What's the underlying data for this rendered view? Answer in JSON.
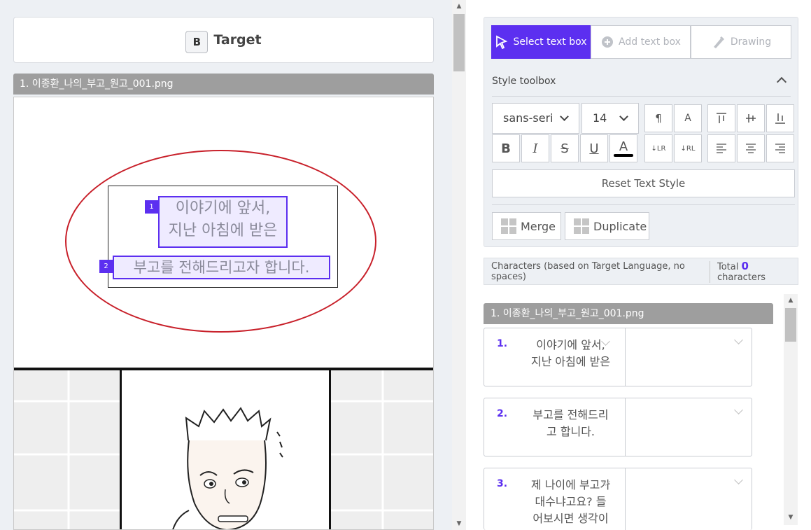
{
  "left_panel": {
    "target_badge": "B",
    "target_title": "Target",
    "file_name": "1. 이종환_나의_부고_원고_001.png",
    "text_boxes": [
      {
        "number": "1",
        "line1": "이야기에 앞서,",
        "line2": "지난 아침에 받은"
      },
      {
        "number": "2",
        "line1": "부고를 전해드리고자 합니다."
      }
    ]
  },
  "toolbar": {
    "select_text_box": "Select text box",
    "add_text_box": "Add text box",
    "drawing": "Drawing",
    "style_toolbox": "Style toolbox",
    "font_family": "sans-serif",
    "font_size": "14",
    "bold": "B",
    "italic": "I",
    "underline": "U",
    "font_color": "A",
    "font_color_value": "#000000",
    "reset_text_style": "Reset Text Style",
    "merge": "Merge",
    "duplicate": "Duplicate",
    "accent_color": "#5c2ff0"
  },
  "characters": {
    "label": "Characters (based on Target Language, no spaces)",
    "total_label": "Total",
    "total_value": "0",
    "unit": "characters"
  },
  "segments": {
    "file_name": "1. 이종환_나의_부고_원고_001.png",
    "items": [
      {
        "number": "1.",
        "text": "이야기에 앞서,\n지난 아침에 받은"
      },
      {
        "number": "2.",
        "text": "부고를 전해드리\n고 합니다."
      },
      {
        "number": "3.",
        "text": "제 나이에 부고가\n대수냐고요? 들\n어보시면 생각이"
      }
    ]
  }
}
